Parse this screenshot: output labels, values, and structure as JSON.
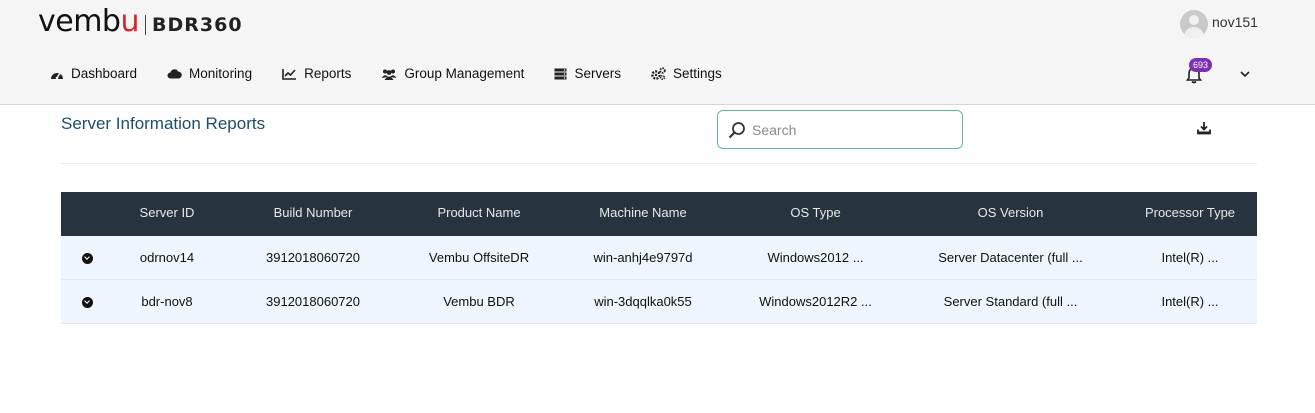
{
  "brand": {
    "logo_main_a": "vemb",
    "logo_main_u": "u",
    "product": "BDR360"
  },
  "user": {
    "name": "nov151"
  },
  "nav": [
    {
      "label": "Dashboard",
      "icon": "dashboard-icon"
    },
    {
      "label": "Monitoring",
      "icon": "cloud-icon"
    },
    {
      "label": "Reports",
      "icon": "line-chart-icon"
    },
    {
      "label": "Group Management",
      "icon": "users-icon"
    },
    {
      "label": "Servers",
      "icon": "server-icon"
    },
    {
      "label": "Settings",
      "icon": "gears-icon"
    }
  ],
  "notifications": {
    "count": "693"
  },
  "page": {
    "title": "Server Information Reports"
  },
  "search": {
    "placeholder": "Search",
    "value": ""
  },
  "table": {
    "columns": [
      "",
      "Server ID",
      "Build Number",
      "Product Name",
      "Machine Name",
      "OS Type",
      "OS Version",
      "Processor Type"
    ],
    "rows": [
      [
        "",
        "odrnov14",
        "3912018060720",
        "Vembu OffsiteDR",
        "win-anhj4e9797d",
        "Windows2012 ...",
        "Server Datacenter (full ...",
        "Intel(R) ..."
      ],
      [
        "",
        "bdr-nov8",
        "3912018060720",
        "Vembu BDR",
        "win-3dqqlka0k55",
        "Windows2012R2 ...",
        "Server Standard (full ...",
        "Intel(R) ..."
      ]
    ]
  },
  "colors": {
    "header_bg": "#f5f5f5",
    "table_header_bg": "#27333f",
    "row_bg": "#eef5fc",
    "accent_green": "#5dc08a",
    "badge": "#7b2fb5",
    "title": "#1f4f63"
  }
}
